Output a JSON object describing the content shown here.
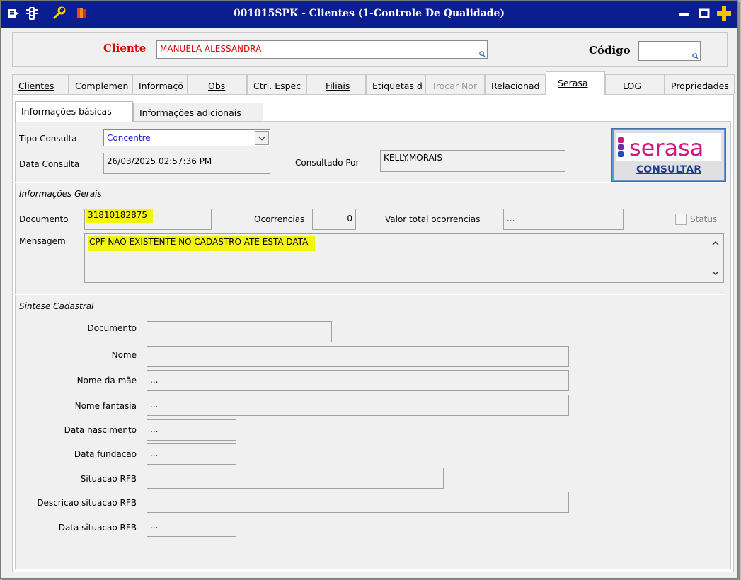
{
  "window": {
    "title": "001015SPK - Clientes (1-Controle De Qualidade)"
  },
  "client_bar": {
    "cliente_label": "Cliente",
    "cliente_value": "MANUELA ALESSANDRA",
    "codigo_label": "Código",
    "codigo_value": ""
  },
  "tabs": [
    {
      "label": "Clientes",
      "accel": "C"
    },
    {
      "label": "Complemen",
      "accel": "m"
    },
    {
      "label": "Informaçõ",
      "accel": "I"
    },
    {
      "label": "Obs",
      "accel": "O"
    },
    {
      "label": "Ctrl. Espec",
      "accel": ""
    },
    {
      "label": "Filiais",
      "accel": "F"
    },
    {
      "label": "Etiquetas d",
      "accel": ""
    },
    {
      "label": "Trocar Nor",
      "accel": "T"
    },
    {
      "label": "Relacionad",
      "accel": "R"
    },
    {
      "label": "Serasa",
      "accel": "S"
    },
    {
      "label": "LOG",
      "accel": ""
    },
    {
      "label": "Propriedades",
      "accel": ""
    }
  ],
  "subtabs": [
    {
      "label": "Informações básicas"
    },
    {
      "label": "Informações adicionais"
    }
  ],
  "consulta": {
    "tipo_label": "Tipo Consulta",
    "tipo_value": "Concentre",
    "data_label": "Data Consulta",
    "data_value": "26/03/2025 02:57:36 PM",
    "por_label": "Consultado Por",
    "por_value": "KELLY.MORAIS"
  },
  "serasa_button": {
    "logo_text": "serasa",
    "label": "CONSULTAR"
  },
  "gerais": {
    "section_title": "Informações Gerais",
    "documento_label": "Documento",
    "documento_value": "31810182875",
    "ocorrencias_label": "Ocorrencias",
    "ocorrencias_value": "0",
    "valor_label": "Valor total ocorrencias",
    "valor_value": "...",
    "status_label": "Status",
    "mensagem_label": "Mensagem",
    "mensagem_value": "CPF NAO EXISTENTE NO CADASTRO ATE ESTA DATA"
  },
  "sintese": {
    "section_title": "Sintese Cadastral",
    "fields": [
      {
        "label": "Documento",
        "value": ""
      },
      {
        "label": "Nome",
        "value": ""
      },
      {
        "label": "Nome da mãe",
        "value": "..."
      },
      {
        "label": "Nome fantasia",
        "value": "..."
      },
      {
        "label": "Data nascimento",
        "value": "..."
      },
      {
        "label": "Data fundacao",
        "value": "..."
      },
      {
        "label": "Situacao RFB",
        "value": ""
      },
      {
        "label": "Descricao situacao RFB",
        "value": ""
      },
      {
        "label": "Data situacao RFB",
        "value": "..."
      }
    ]
  },
  "colors": {
    "titlebar": "#0b1e8f",
    "highlight": "#f4f50e",
    "cliente_label": "#e00000",
    "serasa_pink": "#d01680",
    "consultar_blue": "#1f3d8a"
  }
}
